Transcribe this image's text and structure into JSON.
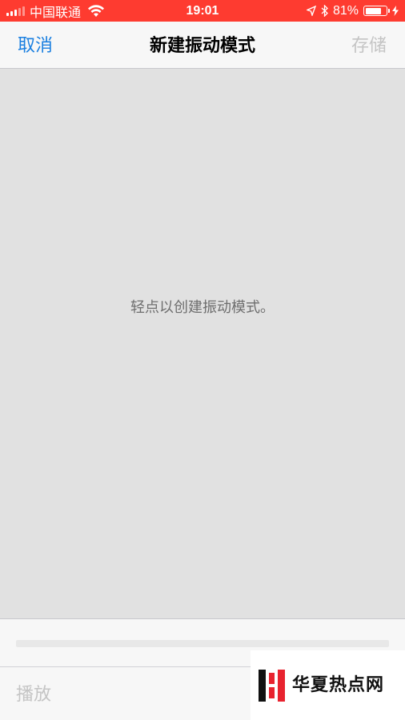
{
  "status_bar": {
    "carrier": "中国联通",
    "time": "19:01",
    "battery": "81%",
    "battery_level": 0.81
  },
  "nav": {
    "cancel": "取消",
    "title": "新建振动模式",
    "save": "存储"
  },
  "canvas": {
    "hint": "轻点以创建振动模式。"
  },
  "toolbar": {
    "play": "播放"
  },
  "watermark": {
    "text": "华夏热点网"
  },
  "colors": {
    "status_bar": "#fe3b30",
    "accent": "#1a7fe0",
    "disabled": "#c4c4c4",
    "canvas": "#e1e1e1"
  }
}
